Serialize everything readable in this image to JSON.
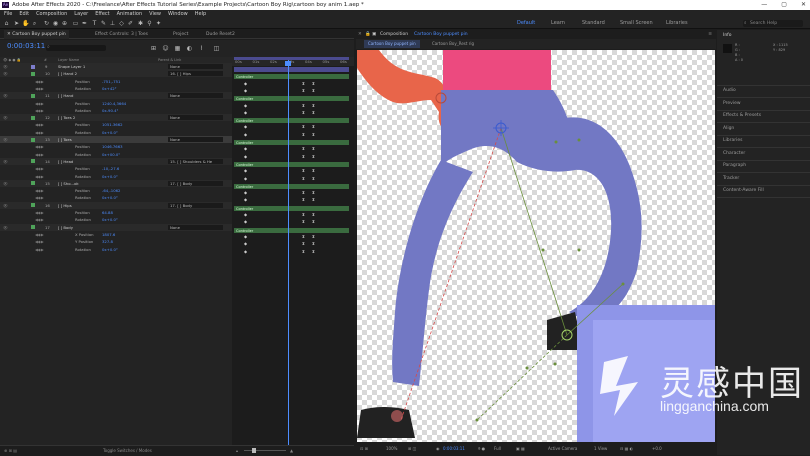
{
  "window": {
    "title": "Adobe After Effects 2020 - C:\\Freelance\\After Effects Tutorial Series\\Example Projects\\Cartoon Boy Rig\\cartoon boy anim 1.aep *"
  },
  "menu": [
    "File",
    "Edit",
    "Composition",
    "Layer",
    "Effect",
    "Animation",
    "View",
    "Window",
    "Help"
  ],
  "workspaces": {
    "default": "Default",
    "learn": "Learn",
    "standard": "Standard",
    "small_screen": "Small Screen",
    "libraries": "Libraries"
  },
  "help_search": "Search Help",
  "left_tabs": {
    "timeline": "Cartoon Boy puppet pin",
    "effect_controls": "Effect Controls: 3 | Toes",
    "project": "Project",
    "dude_reset": "Dude Reset2"
  },
  "timeline": {
    "timecode": "0:00:03:11",
    "columns": {
      "layer_name": "Layer Name",
      "parent": "Parent & Link"
    },
    "ruler_ticks": [
      "00s",
      "01s",
      "02s",
      "03s",
      "04s",
      "05s",
      "06s"
    ],
    "controller_label": "Controller",
    "footer": "Toggle Switches / Modes"
  },
  "layers": [
    {
      "num": "9",
      "name": "Shape Layer 1",
      "parent": "None",
      "color": "#7d7dcc"
    },
    {
      "num": "10",
      "name": "[ ] Hand 2",
      "parent": "16. [ ] Hips",
      "color": "#4fa35a"
    },
    {
      "prop": "Position",
      "value": "-751,-751"
    },
    {
      "prop": "Rotation",
      "value": "0x+42°"
    },
    {
      "num": "11",
      "name": "[ ] Hand",
      "parent": "None",
      "color": "#4fa35a"
    },
    {
      "prop": "Position",
      "value": "1240.4,3664"
    },
    {
      "prop": "Rotation",
      "value": "0x-90.4°"
    },
    {
      "num": "12",
      "name": "[ ] Toes 2",
      "parent": "None",
      "color": "#4fa35a"
    },
    {
      "prop": "Position",
      "value": "1051.3662"
    },
    {
      "prop": "Rotation",
      "value": "0x+0.0°"
    },
    {
      "num": "13",
      "name": "[ ] Toes",
      "parent": "None",
      "color": "#4fa35a",
      "selected": true
    },
    {
      "prop": "Position",
      "value": "1046.7663"
    },
    {
      "prop": "Rotation",
      "value": "0x+00.0°"
    },
    {
      "num": "14",
      "name": "[ ] Head",
      "parent": "15. [ ] Shoulders & He",
      "color": "#4fa35a"
    },
    {
      "prop": "Position",
      "value": "-10,-27.6"
    },
    {
      "prop": "Rotation",
      "value": "0x+0.0°"
    },
    {
      "num": "15",
      "name": "[ ] Sho...ok",
      "parent": "17. [ ] Body",
      "color": "#4fa35a"
    },
    {
      "prop": "Position",
      "value": "-64,-1062"
    },
    {
      "prop": "Rotation",
      "value": "0x+0.0°"
    },
    {
      "num": "16",
      "name": "[ ] Hips",
      "parent": "17. [ ] Body",
      "color": "#4fa35a"
    },
    {
      "prop": "Position",
      "value": "64.88"
    },
    {
      "prop": "Rotation",
      "value": "0x+0.0°"
    },
    {
      "num": "17",
      "name": "[ ] Body",
      "parent": "None",
      "color": "#4fa35a"
    },
    {
      "prop": "X Position",
      "value": "1807.6"
    },
    {
      "prop": "Y Position",
      "value": "327.8"
    },
    {
      "prop": "Rotation",
      "value": "0x+0.0°"
    }
  ],
  "comp": {
    "panel_tab": "Composition",
    "panel_tab_name": "Cartoon Boy puppet pin",
    "sub_tabs": [
      "Cartoon Boy puppet pin",
      "Cartoon Boy_Rest rig"
    ],
    "footer": {
      "zoom": "100%",
      "timecode": "0:00:03:11",
      "resolution": "Full",
      "camera": "Active Camera",
      "view": "1 View",
      "exposure": "+0.0"
    }
  },
  "right_panel": {
    "info": "Info",
    "rgb": [
      "R :",
      "G :",
      "B :",
      "A : 0"
    ],
    "coords": [
      "X : 1115",
      "Y : 829"
    ],
    "items": [
      "Audio",
      "Preview",
      "Effects & Presets",
      "Align",
      "Libraries",
      "Character",
      "Paragraph",
      "Tracker",
      "Content-Aware Fill"
    ]
  },
  "watermark": {
    "cn": "灵感中国",
    "en": "lingganchina.com"
  },
  "colors": {
    "accent": "#4d8dff",
    "legs": "#7278c4",
    "shirt": "#ec4a7f",
    "hand": "#e8654a",
    "box": "#8e95e8"
  }
}
